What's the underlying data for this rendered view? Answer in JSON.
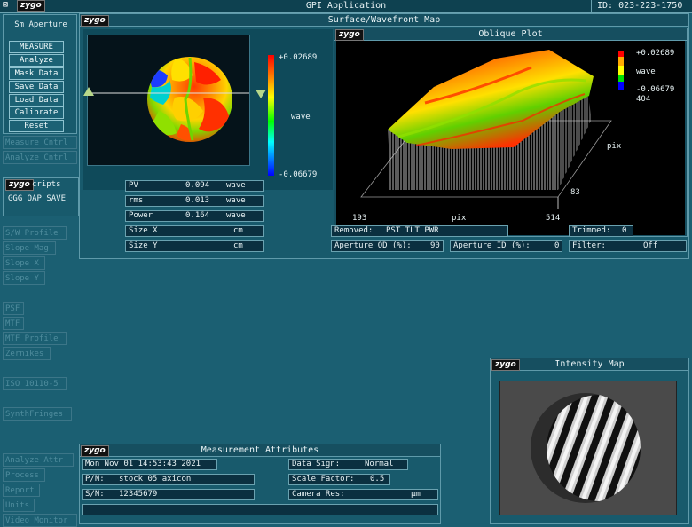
{
  "title_bar": {
    "close_glyph": "⊠",
    "logo": "zygo",
    "app_title": "GPI Application",
    "id_label": "ID:",
    "id_value": "023-223-1750"
  },
  "left_panel": {
    "logo": "zygo",
    "aperture_title": "Sm Aperture",
    "buttons": [
      "MEASURE",
      "Analyze",
      "Mask Data",
      "Save Data",
      "Load Data",
      "Calibrate",
      "Reset"
    ],
    "controls": [
      "Measure Cntrl",
      "Analyze Cntrl"
    ],
    "scripts_logo": "zygo",
    "scripts_label": "cripts",
    "script_item": "GGG OAP SAVE",
    "ghost_group1": [
      "S/W Profile",
      "Slope Mag",
      "Slope X",
      "Slope Y"
    ],
    "ghost_group2": [
      "PSF",
      "MTF",
      "MTF Profile",
      "Zernikes"
    ],
    "ghost_iso": "ISO 10110-5",
    "ghost_synth": "SynthFringes",
    "ghost_bottom": [
      "Analyze Attr",
      "Process",
      "Report",
      "Units",
      "Video Monitor"
    ]
  },
  "surface_map": {
    "logo": "zygo",
    "title": "Surface/Wavefront Map",
    "scale_max": "+0.02689",
    "scale_unit": "wave",
    "scale_min": "-0.06679",
    "stats": [
      {
        "label": "PV",
        "value": "0.094",
        "unit": "wave"
      },
      {
        "label": "rms",
        "value": "0.013",
        "unit": "wave"
      },
      {
        "label": "Power",
        "value": "0.164",
        "unit": "wave"
      },
      {
        "label": "Size X",
        "value": "",
        "unit": "cm"
      },
      {
        "label": "Size Y",
        "value": "",
        "unit": "cm"
      }
    ]
  },
  "oblique_plot": {
    "logo": "zygo",
    "title": "Oblique Plot",
    "scale_max": "+0.02689",
    "scale_unit": "wave",
    "scale_min": "-0.06679",
    "z_value": "404",
    "axis_pix_right": "pix",
    "axis_83": "83",
    "axis_193": "193",
    "axis_pix_bottom": "pix",
    "axis_514": "514",
    "removed_label": "Removed:",
    "removed_value": "PST TLT PWR",
    "trimmed_label": "Trimmed:",
    "trimmed_value": "0",
    "aperture_od_label": "Aperture OD (%):",
    "aperture_od_value": "90",
    "aperture_id_label": "Aperture ID (%):",
    "aperture_id_value": "0",
    "filter_label": "Filter:",
    "filter_value": "Off"
  },
  "intensity_map": {
    "logo": "zygo",
    "title": "Intensity Map"
  },
  "measurement_attributes": {
    "logo": "zygo",
    "title": "Measurement Attributes",
    "date": "Mon Nov 01 14:53:43 2021",
    "pn_label": "P/N:",
    "pn_value": "stock 05 axicon",
    "sn_label": "S/N:",
    "sn_value": "12345679",
    "data_sign_label": "Data Sign:",
    "data_sign_value": "Normal",
    "scale_factor_label": "Scale Factor:",
    "scale_factor_value": "0.5",
    "camera_res_label": "Camera Res:",
    "camera_res_unit": "µm",
    "note": ""
  },
  "colors": {
    "background": "#1b5f72",
    "titlebar": "#0e4150",
    "field": "#0b3040",
    "accent_border": "#6aa2b0"
  }
}
